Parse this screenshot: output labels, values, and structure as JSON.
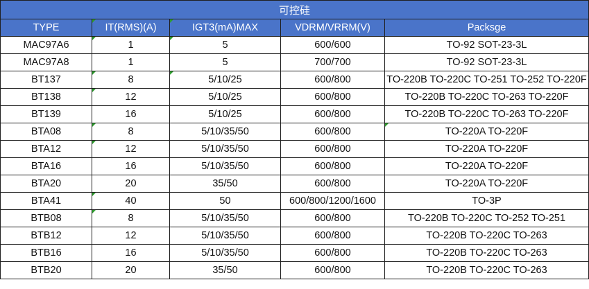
{
  "table": {
    "title": "可控硅",
    "headers": [
      "TYPE",
      "IT(RMS)(A)",
      "IGT3(mA)MAX",
      "VDRM/VRRM(V)",
      "Packsge"
    ],
    "rows": [
      [
        "MAC97A6",
        "1",
        "5",
        "600/600",
        "TO-92 SOT-23-3L"
      ],
      [
        "MAC97A8",
        "1",
        "5",
        "700/700",
        "TO-92 SOT-23-3L"
      ],
      [
        "BT137",
        "8",
        "5/10/25",
        "600/800",
        "TO-220B TO-220C TO-251 TO-252 TO-220F"
      ],
      [
        "BT138",
        "12",
        "5/10/25",
        "600/800",
        "TO-220B TO-220C TO-263 TO-220F"
      ],
      [
        "BT139",
        "16",
        "5/10/25",
        "600/800",
        "TO-220B TO-220C TO-263 TO-220F"
      ],
      [
        "BTA08",
        "8",
        "5/10/35/50",
        "600/800",
        "TO-220A TO-220F"
      ],
      [
        "BTA12",
        "12",
        "5/10/35/50",
        "600/800",
        "TO-220A TO-220F"
      ],
      [
        "BTA16",
        "16",
        "5/10/35/50",
        "600/800",
        "TO-220A TO-220F"
      ],
      [
        "BTA20",
        "20",
        "35/50",
        "600/800",
        "TO-220A TO-220F"
      ],
      [
        "BTA41",
        "40",
        "50",
        "600/800/1200/1600",
        "TO-3P"
      ],
      [
        "BTB08",
        "8",
        "5/10/35/50",
        "600/800",
        "TO-220B TO-220C TO-252 TO-251"
      ],
      [
        "BTB12",
        "12",
        "5/10/35/50",
        "600/800",
        "TO-220B TO-220C TO-263"
      ],
      [
        "BTB16",
        "16",
        "5/10/35/50",
        "600/800",
        "TO-220B TO-220C TO-263"
      ],
      [
        "BTB20",
        "20",
        "35/50",
        "600/800",
        "TO-220B TO-220C TO-263"
      ]
    ]
  },
  "colors": {
    "header_bg": "#4a74c9",
    "header_text": "#ffffff",
    "grid_line": "#1f1f1f",
    "comment_marker": "#2e9a2e"
  }
}
